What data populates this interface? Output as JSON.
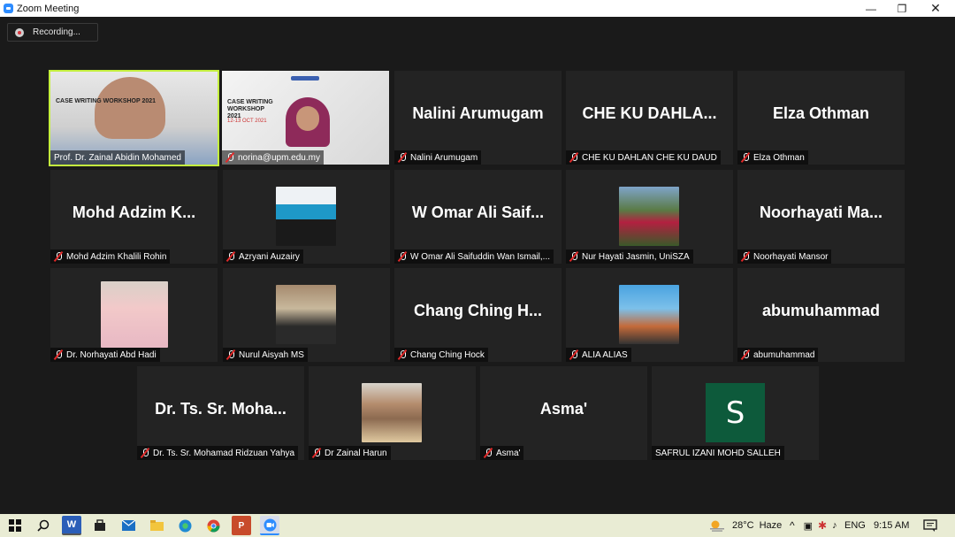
{
  "window": {
    "title": "Zoom Meeting"
  },
  "recording": {
    "label": "Recording..."
  },
  "shared_slide": {
    "title": "CASE WRITING WORKSHOP 2021",
    "dates": "12-13 OCT 2021"
  },
  "participants": [
    {
      "big": "",
      "caption": "Prof. Dr. Zainal Abidin Mohamed",
      "muted": false
    },
    {
      "big": "",
      "caption": "norina@upm.edu.my",
      "muted": true
    },
    {
      "big": "Nalini Arumugam",
      "caption": "Nalini Arumugam",
      "muted": true
    },
    {
      "big": "CHE KU DAHLA...",
      "caption": "CHE KU DAHLAN CHE KU DAUD",
      "muted": true
    },
    {
      "big": "Elza Othman",
      "caption": "Elza Othman",
      "muted": true
    },
    {
      "big": "Mohd Adzim K...",
      "caption": "Mohd Adzim Khalili Rohin",
      "muted": true
    },
    {
      "big": "",
      "caption": "Azryani Auzairy",
      "muted": true
    },
    {
      "big": "W Omar Ali Saif...",
      "caption": "W Omar Ali Saifuddin Wan Ismail,...",
      "muted": true
    },
    {
      "big": "",
      "caption": "Nur Hayati Jasmin, UniSZA",
      "muted": true
    },
    {
      "big": "Noorhayati  Ma...",
      "caption": "Noorhayati Mansor",
      "muted": true
    },
    {
      "big": "",
      "caption": "Dr. Norhayati Abd Hadi",
      "muted": true
    },
    {
      "big": "",
      "caption": "Nurul Aisyah MS",
      "muted": true
    },
    {
      "big": "Chang Ching H...",
      "caption": "Chang Ching Hock",
      "muted": true
    },
    {
      "big": "",
      "caption": "ALIA ALIAS",
      "muted": true
    },
    {
      "big": "abumuhammad",
      "caption": "abumuhammad",
      "muted": true
    },
    {
      "big": "Dr. Ts. Sr. Moha...",
      "caption": "Dr. Ts. Sr. Mohamad Ridzuan Yahya",
      "muted": true
    },
    {
      "big": "",
      "caption": "Dr Zainal Harun",
      "muted": true
    },
    {
      "big": "Asma'",
      "caption": "Asma'",
      "muted": true
    },
    {
      "big": "",
      "caption": "SAFRUL IZANI MOHD SALLEH",
      "muted": false,
      "avatar_letter": "S"
    }
  ],
  "taskbar": {
    "weather_temp": "28°C",
    "weather_desc": "Haze",
    "lang": "ENG",
    "time": "9:15 AM"
  },
  "colors": {
    "active_speaker": "#c4ef3e",
    "tile_bg": "#232323",
    "taskbar_bg": "#e9ecd4"
  }
}
